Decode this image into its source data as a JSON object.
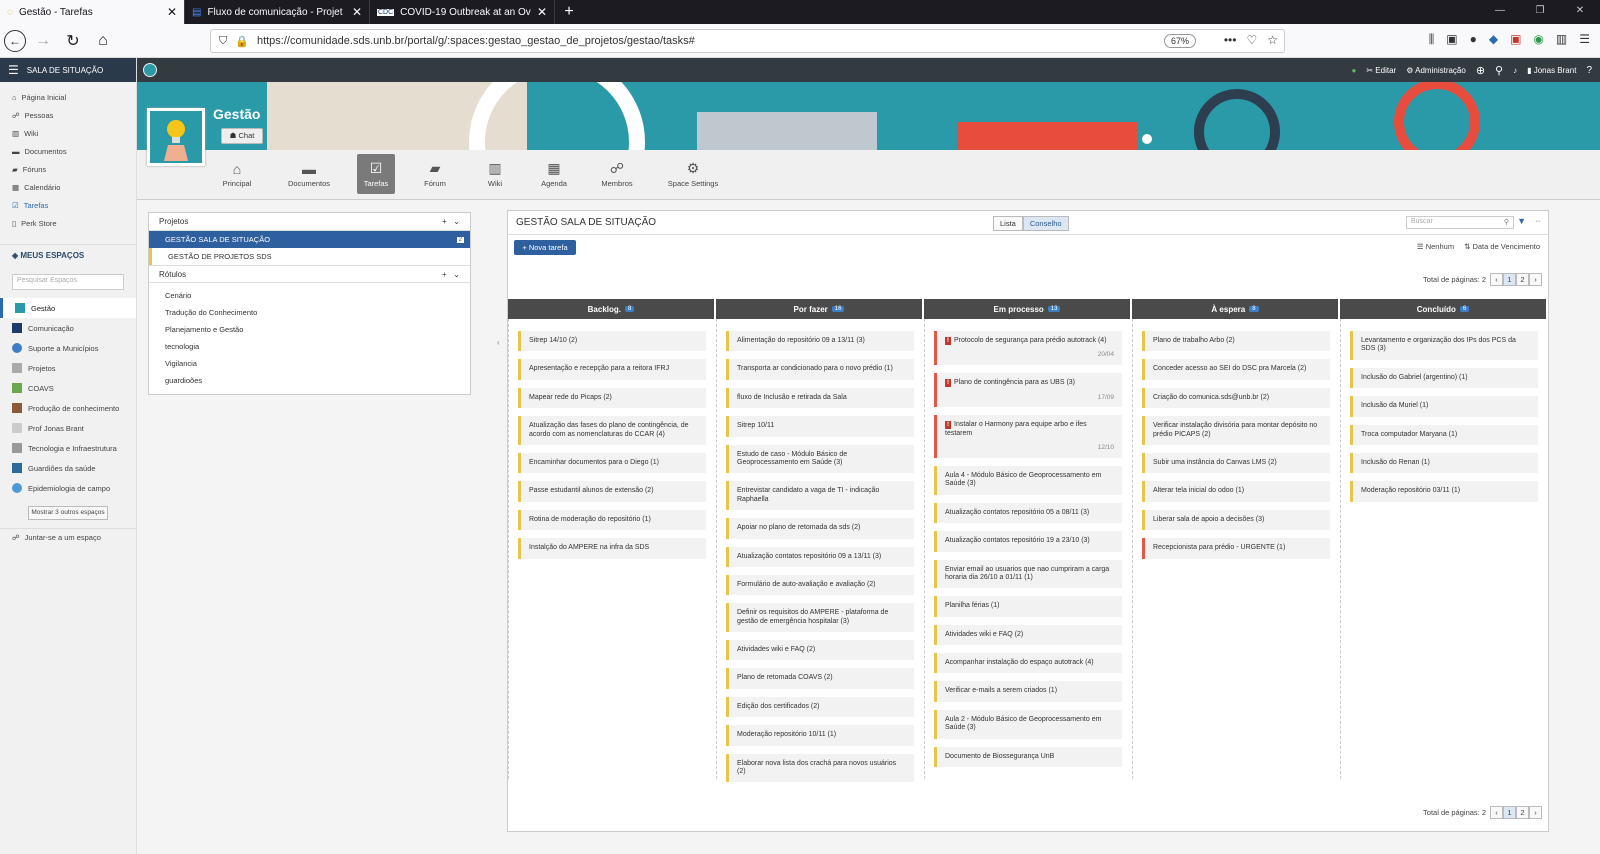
{
  "browser": {
    "tabs": [
      {
        "title": "Gestão - Tarefas",
        "active": true
      },
      {
        "title": "Fluxo de comunicação - Projet",
        "active": false
      },
      {
        "title": "COVID-19 Outbreak at an Over",
        "active": false
      }
    ],
    "url": "https://comunidade.sds.unb.br/portal/g/:spaces:gestao_gestao_de_projetos/gestao/tasks#",
    "zoom": "67%"
  },
  "leftnav": {
    "header": "SALA DE SITUAÇÃO",
    "items": [
      "Página Inicial",
      "Pessoas",
      "Wiki",
      "Documentos",
      "Fóruns",
      "Calendário",
      "Tarefas",
      "Perk Store"
    ],
    "spaces_title": "MEUS ESPAÇOS",
    "search_placeholder": "Pesquisar Espaços",
    "spaces": [
      "Gestão",
      "Comunicação",
      "Suporte a Municípios",
      "Projetos",
      "COAVS",
      "Produção de conhecimento",
      "Prof Jonas Brant",
      "Tecnologia e Infraestrutura",
      "Guardiões da saúde",
      "Epidemiologia de campo"
    ],
    "more_button": "Mostrar 3 outros espaços",
    "join": "Juntar-se a um espaço"
  },
  "appbar": {
    "edit": "Editar",
    "admin": "Administração",
    "user": "Jonas Brant"
  },
  "space": {
    "title": "Gestão",
    "chat": "Chat",
    "tabs": [
      "Principal",
      "Documentos",
      "Tarefas",
      "Fórum",
      "Wiki",
      "Agenda",
      "Membros",
      "Space Settings"
    ]
  },
  "projects": {
    "header": "Projetos",
    "items": [
      {
        "name": "GESTÃO SALA DE SITUAÇÃO",
        "count": "2"
      },
      {
        "name": "GESTÃO DE PROJETOS SDS"
      }
    ],
    "labels_header": "Rótulos",
    "labels": [
      "Cenário",
      "Tradução do Conhecimento",
      "Planejamento e Gestão",
      "tecnologia",
      "Vigilancia",
      "guardioões"
    ]
  },
  "board": {
    "title": "GESTÃO SALA DE SITUAÇÃO",
    "view_list": "Lista",
    "view_board": "Conselho",
    "search_placeholder": "Buscar",
    "new_task": "+ Nova tarefa",
    "sort_none": "Nenhum",
    "sort_due": "Data de Vencimento",
    "pages_label": "Total de páginas: 2",
    "page1": "1",
    "page2": "2",
    "columns": [
      {
        "title": "Backlog.",
        "count": "8",
        "cards": [
          {
            "text": "Sitrep 14/10 (2)"
          },
          {
            "text": "Apresentação e recepção para a reitora IFRJ"
          },
          {
            "text": "Mapear rede do Picaps (2)"
          },
          {
            "text": "Atualização das fases do plano de contingência, de acordo com as nomenclaturas do CCAR (4)"
          },
          {
            "text": "Encaminhar documentos para o Diego (1)"
          },
          {
            "text": "Passe estudantil alunos de extensão (2)"
          },
          {
            "text": "Rotina de moderação do repositório (1)"
          },
          {
            "text": "Instalção do AMPERE na infra da SDS"
          }
        ]
      },
      {
        "title": "Por fazer",
        "count": "16",
        "cards": [
          {
            "text": "Alimentação do repositório 09 a 13/11 (3)"
          },
          {
            "text": "Transporta ar condicionado para o novo prédio (1)"
          },
          {
            "text": "fluxo de Inclusão e retirada da Sala"
          },
          {
            "text": "Sitrep 10/11"
          },
          {
            "text": "Estudo de caso - Módulo Básico de Geoprocessamento em Saúde (3)"
          },
          {
            "text": "Entrevistar candidato a vaga de TI - indicação Raphaella"
          },
          {
            "text": "Apoiar no plano de retomada da sds (2)"
          },
          {
            "text": "Atualização contatos repositório 09 a 13/11 (3)"
          },
          {
            "text": "Formulário de auto-avaliação e avaliação (2)"
          },
          {
            "text": "Definir os requisitos do AMPERE - plataforma de gestão de emergência hospitalar (3)"
          },
          {
            "text": "Atividades wiki e FAQ (2)"
          },
          {
            "text": "Plano de retomada COAVS (2)"
          },
          {
            "text": "Edição dos certificados (2)"
          },
          {
            "text": "Moderação repositório 10/11 (1)"
          },
          {
            "text": "Elaborar nova lista dos crachá para novos usuários (2)"
          }
        ]
      },
      {
        "title": "Em processo",
        "count": "13",
        "cards": [
          {
            "text": "Protocolo de segurança para prédio autotrack (4)",
            "date": "20/04",
            "urgent": true
          },
          {
            "text": "Plano de contingência para as UBS (3)",
            "date": "17/09",
            "urgent": true
          },
          {
            "text": "Instalar o Harmony para equipe arbo e ifes testarem",
            "date": "12/10",
            "urgent": true
          },
          {
            "text": "Aula 4 - Módulo Básico de Geoprocessamento em Saúde (3)"
          },
          {
            "text": "Atualização contatos repositório 05 a 08/11 (3)"
          },
          {
            "text": "Atualização contatos repositório 19 a 23/10 (3)"
          },
          {
            "text": "Enviar email ao usuarios que nao cumpriram a carga horaria dia 26/10 a 01/11 (1)"
          },
          {
            "text": "Planilha férias (1)"
          },
          {
            "text": "Atividades wiki e FAQ (2)"
          },
          {
            "text": "Acompanhar instalação do espaço autotrack (4)"
          },
          {
            "text": "Verificar e-mails a serem criados (1)"
          },
          {
            "text": "Aula 2 - Módulo Básico de Geoprocessamento em Saúde (3)"
          },
          {
            "text": "Documento de Biossegurança UnB"
          }
        ]
      },
      {
        "title": "À espera",
        "count": "8",
        "cards": [
          {
            "text": "Plano de trabalho Arbo (2)"
          },
          {
            "text": "Conceder acesso ao SEI do DSC pra Marcela (2)"
          },
          {
            "text": "Criação do comunica.sds@unb.br (2)"
          },
          {
            "text": "Verificar instalação divisória para montar depósito no prédio PICAPS (2)"
          },
          {
            "text": "Subir uma instância do Canvas LMS (2)"
          },
          {
            "text": "Alterar tela inicial do odoo (1)"
          },
          {
            "text": "Liberar sala de apoio a decisões (3)"
          },
          {
            "text": "Recepcionista para prédio - URGENTE (1)",
            "urgent": true
          }
        ]
      },
      {
        "title": "Concluído",
        "count": "6",
        "cards": [
          {
            "text": "Levantamento e organização dos IPs dos PCS da SDS (3)"
          },
          {
            "text": "Inclusão do Gabriel (argentino) (1)"
          },
          {
            "text": "Inclusão da Muriel (1)"
          },
          {
            "text": "Troca computador Maryana (1)"
          },
          {
            "text": "Inclusão do Renan (1)"
          },
          {
            "text": "Moderação repositório 03/11 (1)"
          }
        ]
      }
    ]
  }
}
